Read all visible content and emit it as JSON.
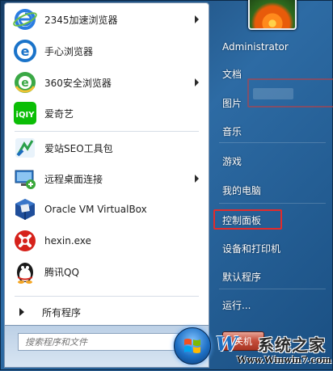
{
  "programs": [
    {
      "label": "2345加速浏览器",
      "icon": "2345-browser-icon",
      "submenu": true
    },
    {
      "label": "手心浏览器",
      "icon": "shouxin-browser-icon",
      "submenu": false
    },
    {
      "label": "360安全浏览器",
      "icon": "360-browser-icon",
      "submenu": true
    },
    {
      "label": "爱奇艺",
      "icon": "iqiyi-icon",
      "submenu": false
    },
    {
      "label": "爱站SEO工具包",
      "icon": "aizhan-seo-icon",
      "submenu": false
    },
    {
      "label": "远程桌面连接",
      "icon": "remote-desktop-icon",
      "submenu": true
    },
    {
      "label": "Oracle VM VirtualBox",
      "icon": "virtualbox-icon",
      "submenu": false
    },
    {
      "label": "hexin.exe",
      "icon": "hexin-icon",
      "submenu": false
    },
    {
      "label": "腾讯QQ",
      "icon": "qq-penguin-icon",
      "submenu": false
    }
  ],
  "all_programs_label": "所有程序",
  "search": {
    "placeholder": "搜索程序和文件",
    "value": ""
  },
  "user": {
    "name": "Administrator"
  },
  "right_items": [
    {
      "label": "文档"
    },
    {
      "label": "图片"
    },
    {
      "label": "音乐"
    },
    {
      "label": "游戏"
    },
    {
      "label": "我的电脑"
    },
    {
      "label": "控制面板",
      "highlighted": true
    },
    {
      "label": "设备和打印机"
    },
    {
      "label": "默认程序"
    },
    {
      "label": "运行..."
    }
  ],
  "shutdown_label": "关机",
  "watermark": {
    "logo": "W",
    "site_name": "系统之家",
    "url": "Www.Winwin7.com"
  },
  "colors": {
    "highlight": "#e32b2b",
    "menu_blue": "#2d6ba4"
  }
}
